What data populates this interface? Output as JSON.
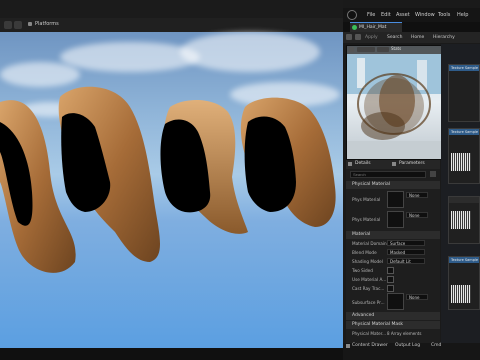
{
  "viewport": {
    "toolbar": {
      "platform_label": "Platforms"
    }
  },
  "menubar": {
    "items": [
      "File",
      "Edit",
      "Asset",
      "Window",
      "Tools",
      "Help"
    ]
  },
  "tab": {
    "title": "MI_Hair_Mat"
  },
  "toolbar": {
    "apply": "Apply",
    "search": "Search",
    "home": "Home",
    "hierarchy": "Hierarchy"
  },
  "preview": {
    "stats": "Stats"
  },
  "details": {
    "tabs": {
      "details": "Details",
      "parameters": "Parameters"
    },
    "search_placeholder": "Search",
    "sections": {
      "physical_material": "Physical Material",
      "material": "Material",
      "advanced": "Advanced",
      "physical_material_mask": "Physical Material Mask"
    },
    "rows": {
      "phys_material": "Phys Material",
      "phys_material_1": "Phys Material",
      "material_domain": "Material Domain",
      "blend_mode": "Blend Mode",
      "shading_model": "Shading Model",
      "two_sided": "Two Sided",
      "use_material_a": "Use Material A...",
      "cast_ray_traced": "Cast Ray Trac...",
      "subsurface_pr": "Subsurface Pr...",
      "physical_mater": "Physical Mater..."
    },
    "values": {
      "none": "None",
      "none_2": "None",
      "none_3": "None",
      "surface": "Surface",
      "masked": "Masked",
      "default_lit": "Default Lit",
      "array": "8 Array elements"
    }
  },
  "graph": {
    "texture_sample": "Texture Sample"
  },
  "statusbar": {
    "content_drawer": "Content Drawer",
    "output_log": "Output Log",
    "cmd": "Cmd"
  }
}
